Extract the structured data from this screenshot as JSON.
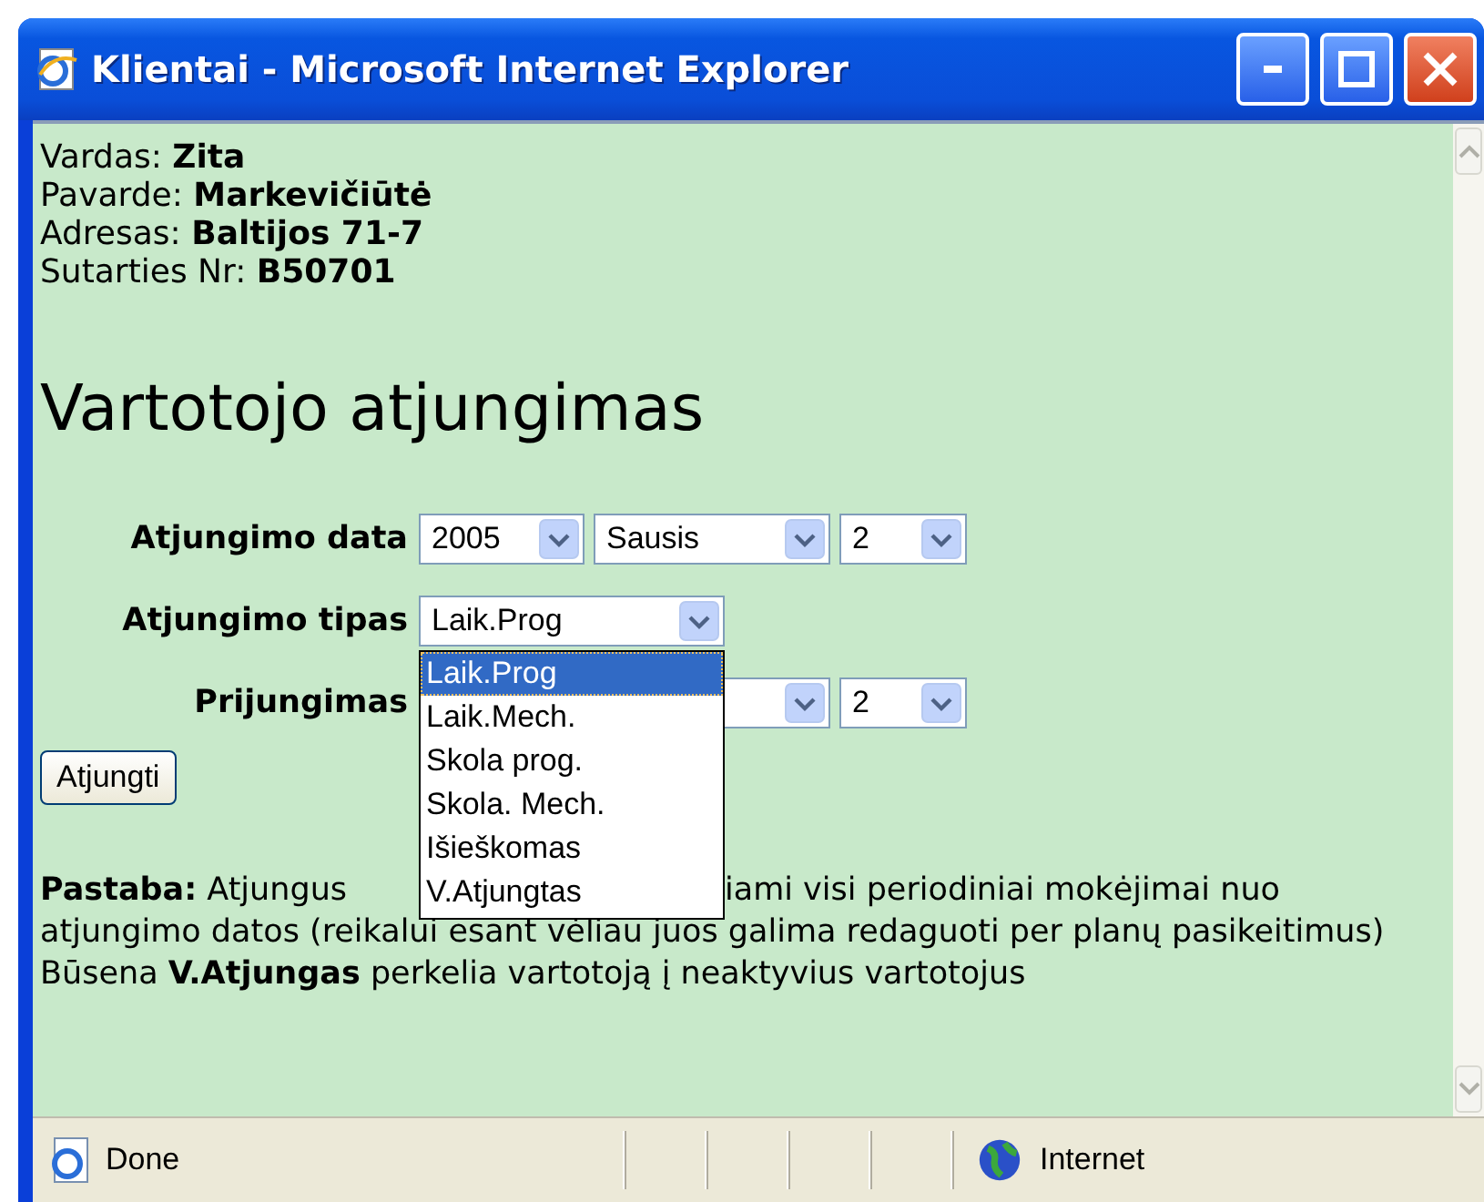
{
  "window": {
    "title": "Klientai - Microsoft Internet Explorer"
  },
  "client": [
    {
      "label": "Vardas:",
      "value": "Zita"
    },
    {
      "label": "Pavarde:",
      "value": "Markevičiūtė"
    },
    {
      "label": "Adresas:",
      "value": "Baltijos 71-7"
    },
    {
      "label": "Sutarties Nr:",
      "value": "B50701"
    }
  ],
  "heading": "Vartotojo atjungimas",
  "form": {
    "date": {
      "label": "Atjungimo data",
      "year": "2005",
      "month": "Sausis",
      "day": "2"
    },
    "type": {
      "label": "Atjungimo tipas",
      "value": "Laik.Prog",
      "expanded": true,
      "options": [
        {
          "label": "Laik.Prog",
          "selected": true
        },
        {
          "label": "Laik.Mech.",
          "selected": false
        },
        {
          "label": "Skola prog.",
          "selected": false
        },
        {
          "label": "Skola. Mech.",
          "selected": false
        },
        {
          "label": "Išieškomas",
          "selected": false
        },
        {
          "label": "V.Atjungtas",
          "selected": false
        }
      ]
    },
    "reconnect": {
      "label": "Prijungimas",
      "day": "2"
    },
    "submit": "Atjungti"
  },
  "note": {
    "start": "**Pastaba:** Atjungus",
    "end": "iami visi periodiniai mokėjimai nuo",
    "rest": "atjungimo datos (reikalui esant vėliau juos galima redaguoti per planų pasikeitimus)",
    "status": "Būsena **V.Atjungas** perkelia vartotoją į neaktyvius vartotojus"
  },
  "status_bar": {
    "left": "Done",
    "zone": "Internet"
  }
}
